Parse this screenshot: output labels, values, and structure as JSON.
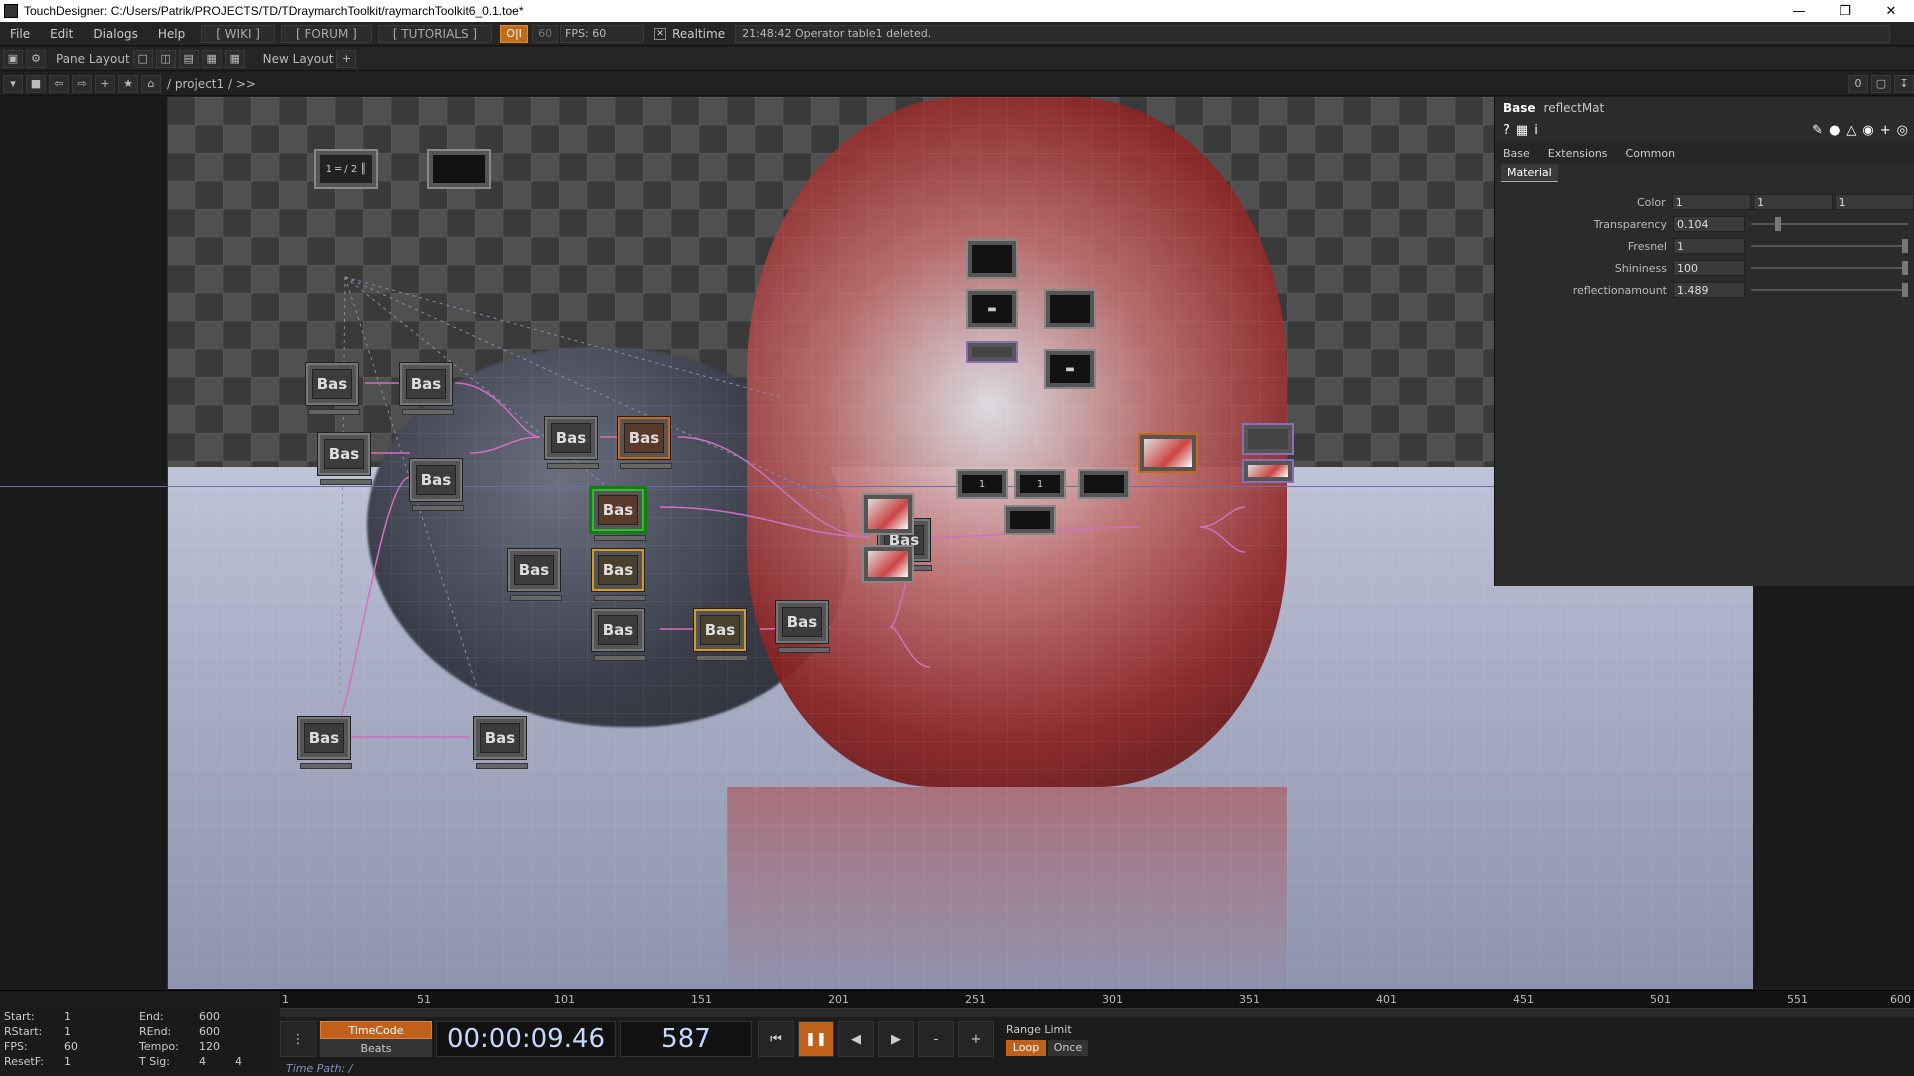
{
  "window": {
    "title": "TouchDesigner: C:/Users/Patrik/PROJECTS/TD/TDraymarchToolkit/raymarchToolkit6_0.1.toe*",
    "minimize": "—",
    "restore": "❐",
    "close": "✕"
  },
  "menu": {
    "items": [
      "File",
      "Edit",
      "Dialogs",
      "Help"
    ],
    "wiki": "[ WIKI ]",
    "forum": "[ FORUM ]",
    "tutorials": "[ TUTORIALS ]",
    "perform": "O|I",
    "fps_target": "60",
    "fps_read": "FPS:  60",
    "realtime_label": "Realtime",
    "message": "21:48:42 Operator table1 deleted."
  },
  "toolbar": {
    "pane_layout": "Pane Layout",
    "new_layout": "New Layout",
    "add": "+"
  },
  "path": {
    "text": "/ project1 / >>",
    "zero": "0"
  },
  "nodes": {
    "bas": "Bas",
    "n1": "1",
    "n2": "1"
  },
  "params": {
    "type": "Base",
    "name": "reflectMat",
    "tabs": [
      "Base",
      "Extensions",
      "Common"
    ],
    "subtab": "Material",
    "rows": [
      {
        "name": "Color",
        "v1": "1",
        "v2": "1",
        "v3": "1"
      },
      {
        "name": "Transparency",
        "v1": "0.104",
        "level": 0.104
      },
      {
        "name": "Fresnel",
        "v1": "1"
      },
      {
        "name": "Shininess",
        "v1": "100"
      },
      {
        "name": "reflectionamount",
        "v1": "1.489"
      }
    ]
  },
  "timeline": {
    "start": {
      "k": "Start:",
      "v": "1"
    },
    "end": {
      "k": "End:",
      "v": "600"
    },
    "rstart": {
      "k": "RStart:",
      "v": "1"
    },
    "rend": {
      "k": "REnd:",
      "v": "600"
    },
    "fps": {
      "k": "FPS:",
      "v": "60"
    },
    "tempo": {
      "k": "Tempo:",
      "v": "120"
    },
    "resetf": {
      "k": "ResetF:",
      "v": "1"
    },
    "tsig": {
      "k": "T Sig:",
      "v": "4",
      "v2": "4"
    },
    "ticks": [
      "1",
      "51",
      "101",
      "151",
      "201",
      "251",
      "301",
      "351",
      "401",
      "451",
      "501",
      "551",
      "600"
    ],
    "timecode_label": "TimeCode",
    "beats_label": "Beats",
    "timecode": "00:00:09.46",
    "frame": "587",
    "range_limit": "Range Limit",
    "loop": "Loop",
    "once": "Once",
    "time_path": "Time Path: /",
    "minus": "-",
    "plus": "+"
  },
  "colors": {
    "accent_orange": "#c0601a",
    "selected_green": "#2ebd2e",
    "wire_pink": "#d070c0"
  }
}
